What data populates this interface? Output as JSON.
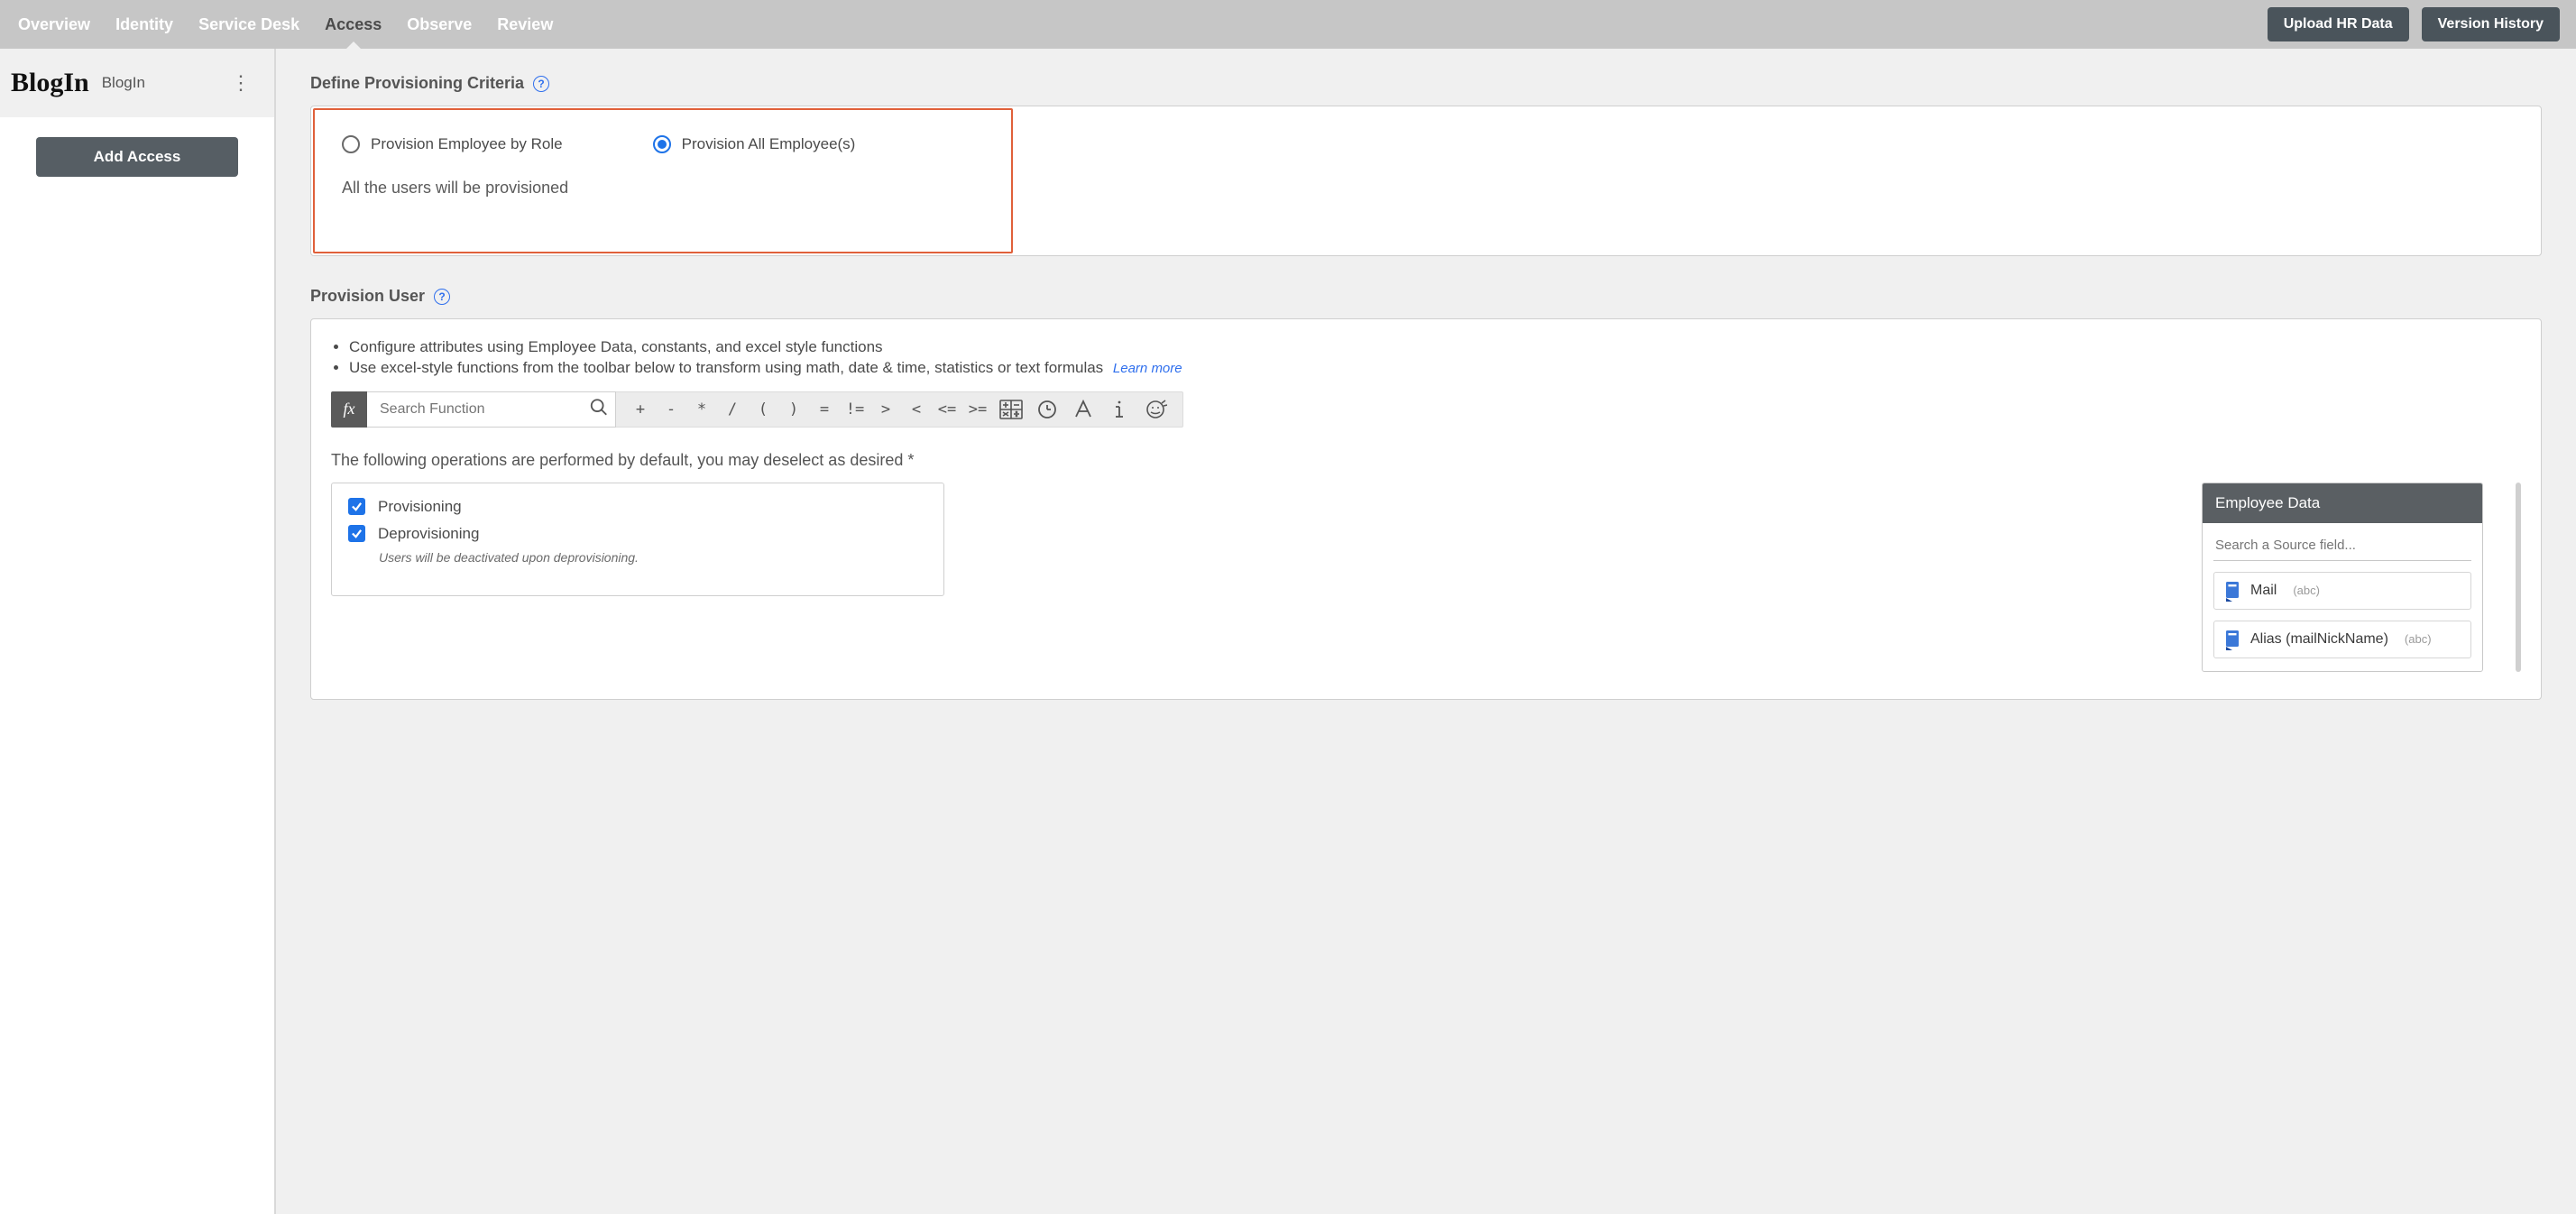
{
  "nav": {
    "tabs": [
      "Overview",
      "Identity",
      "Service Desk",
      "Access",
      "Observe",
      "Review"
    ],
    "active_index": 3,
    "upload_label": "Upload HR Data",
    "version_label": "Version History"
  },
  "sidebar": {
    "logo_text": "BlogIn",
    "app_name": "BlogIn",
    "add_access_label": "Add Access"
  },
  "criteria": {
    "title": "Define Provisioning Criteria",
    "radio_by_role": "Provision Employee by Role",
    "radio_all": "Provision All Employee(s)",
    "selected": "all",
    "description": "All the users will be provisioned"
  },
  "provision": {
    "title": "Provision User",
    "bullet1": "Configure attributes using Employee Data, constants, and excel style functions",
    "bullet2": "Use excel-style functions from the toolbar below to transform using math, date & time, statistics or text formulas",
    "learn_more": "Learn more",
    "fx_label": "fx",
    "search_placeholder": "Search Function",
    "operators": [
      "+",
      "-",
      "*",
      "/",
      "(",
      ")",
      "=",
      "!=",
      ">",
      "<",
      "<=",
      ">="
    ],
    "ops_desc": "The following operations are performed by default, you may deselect as desired *",
    "check_provisioning": "Provisioning",
    "check_deprovisioning": "Deprovisioning",
    "deprov_note": "Users will be deactivated upon deprovisioning."
  },
  "employee_data": {
    "title": "Employee Data",
    "search_placeholder": "Search a Source field...",
    "fields": [
      {
        "name": "Mail",
        "meta": "(abc)"
      },
      {
        "name": "Alias (mailNickName)",
        "meta": "(abc)"
      }
    ]
  }
}
